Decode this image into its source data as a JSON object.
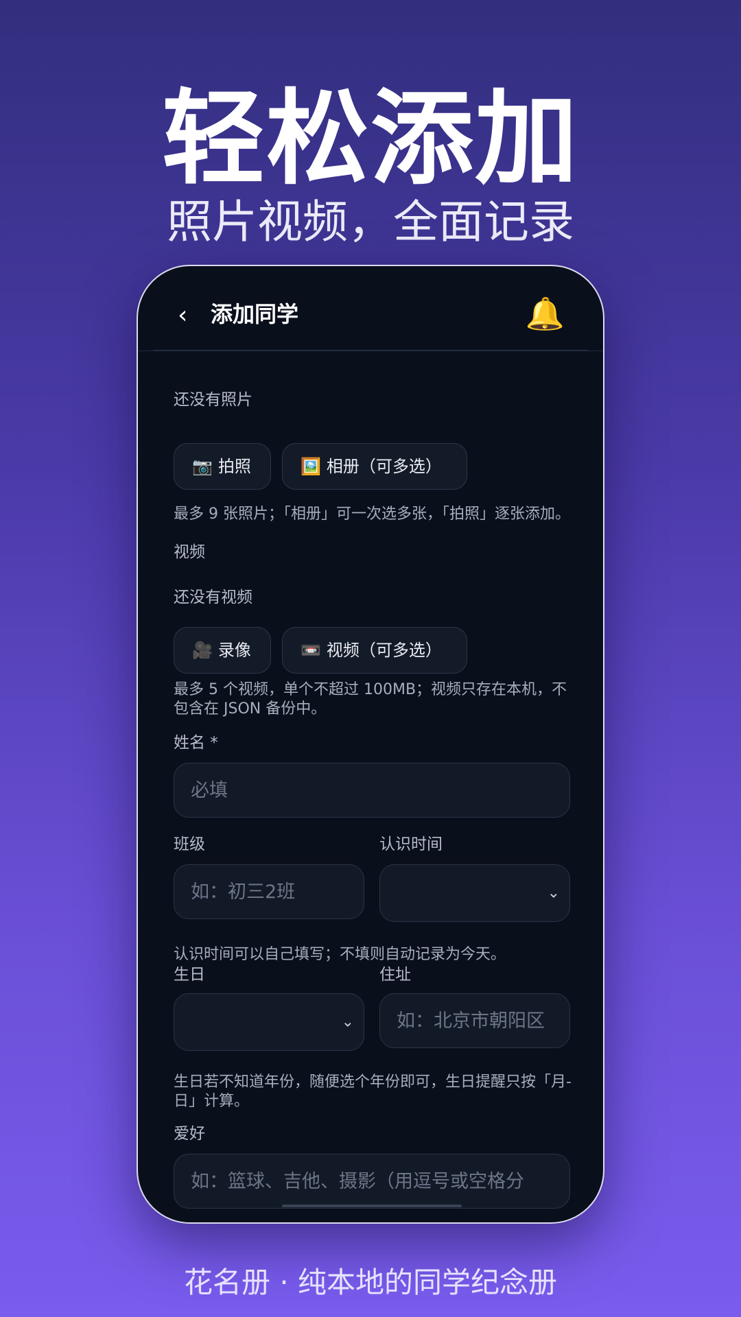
{
  "hero": {
    "title": "轻松添加",
    "subtitle": "照片视频，全面记录"
  },
  "footer": "花名册 · 纯本地的同学纪念册",
  "header": {
    "back_icon": "chevron-left-icon",
    "back_glyph": "‹",
    "title": "添加同学",
    "bell_icon": "bell-icon",
    "bell_glyph": "🔔"
  },
  "photos": {
    "empty_text": "还没有照片",
    "camera_button": "拍照",
    "camera_glyph": "📷",
    "album_button": "相册（可多选）",
    "album_glyph": "🖼️",
    "hint": "最多 9 张照片；「相册」可一次选多张，「拍照」逐张添加。"
  },
  "videos": {
    "section_label": "视频",
    "empty_text": "还没有视频",
    "record_button": "录像",
    "record_glyph": "🎥",
    "video_button": "视频（可多选）",
    "video_glyph": "📼",
    "hint": "最多 5 个视频，单个不超过 100MB；视频只存在本机，不包含在 JSON 备份中。"
  },
  "form": {
    "name_label": "姓名 *",
    "name_placeholder": "必填",
    "class_label": "班级",
    "class_placeholder": "如：初三2班",
    "met_label": "认识时间",
    "met_hint": "认识时间可以自己填写；不填则自动记录为今天。",
    "birthday_label": "生日",
    "address_label": "住址",
    "address_placeholder": "如：北京市朝阳区",
    "birthday_hint": "生日若不知道年份，随便选个年份即可，生日提醒只按「月-日」计算。",
    "hobby_label": "爱好",
    "hobby_placeholder": "如：篮球、吉他、摄影（用逗号或空格分",
    "chevron_glyph": "⌄"
  },
  "colors": {
    "accent": "#7a5cee",
    "card_bg": "#0a0f1c"
  }
}
